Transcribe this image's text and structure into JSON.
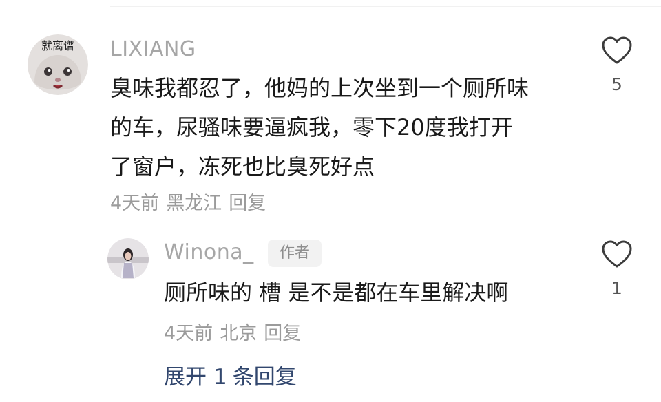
{
  "comment": {
    "avatar_text": "就离谱",
    "username": "LIXIANG",
    "lines": [
      "臭味我都忍了，他妈的上次坐到一个厕所味",
      "的车，尿骚味要逼疯我，零下20度我打开",
      "了窗户，冻死也比臭死好点"
    ],
    "time": "4天前",
    "location": "黑龙江",
    "reply_label": "回复",
    "like_count": "5"
  },
  "reply": {
    "username": "Winona_",
    "badge": "作者",
    "text": "厕所味的 槽 是不是都在车里解决啊",
    "time": "4天前",
    "location": "北京",
    "reply_label": "回复",
    "like_count": "1"
  },
  "expand": {
    "label_prefix": "展开",
    "count": "1",
    "label_suffix": "条回复"
  },
  "colors": {
    "username": "#a6a6a6",
    "text": "#1a1a1a",
    "meta": "#9b9b9b",
    "expand": "#32476e"
  },
  "icons": {
    "like": "heart-outline-icon"
  }
}
